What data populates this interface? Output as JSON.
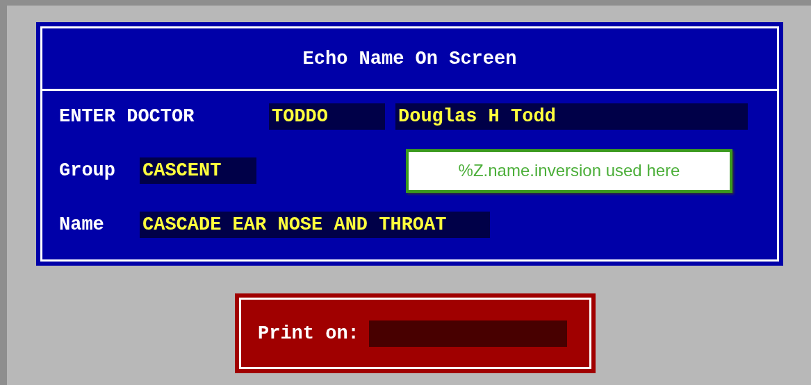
{
  "window": {
    "title": "Echo Name On Screen"
  },
  "rows": [
    {
      "kind": "doctor",
      "label": "ENTER DOCTOR",
      "fields": [
        "TODDO",
        "Douglas H Todd"
      ]
    },
    {
      "kind": "group",
      "label": "Group",
      "fields": [
        "CASCENT"
      ],
      "callout": "%Z.name.inversion used here"
    },
    {
      "kind": "name",
      "label": "Name",
      "fields": [
        "CASCADE EAR NOSE AND THROAT"
      ]
    }
  ],
  "print": {
    "label": "Print on:"
  }
}
